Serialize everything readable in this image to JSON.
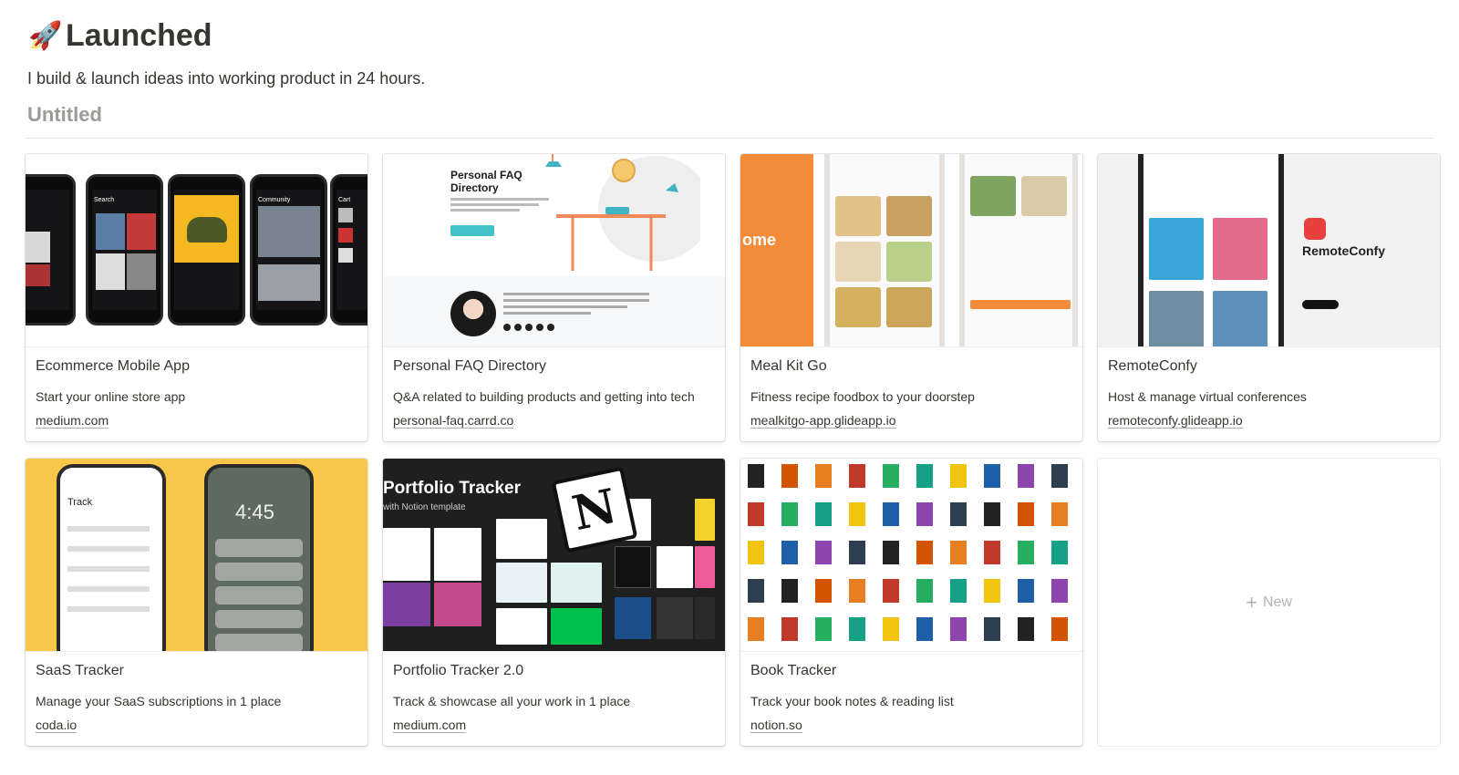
{
  "page": {
    "icon": "rocket-icon",
    "icon_glyph": "🚀",
    "title": "Launched",
    "description": "I build & launch ideas into working product in 24 hours.",
    "view_name": "Untitled"
  },
  "cards": [
    {
      "name": "Ecommerce Mobile App",
      "sub": "Start your online store app",
      "link": "medium.com"
    },
    {
      "name": "Personal FAQ Directory",
      "sub": "Q&A related to building products and getting into tech",
      "link": "personal-faq.carrd.co"
    },
    {
      "name": "Meal Kit Go",
      "sub": "Fitness recipe foodbox to your doorstep",
      "link": "mealkitgo-app.glideapp.io"
    },
    {
      "name": "RemoteConfy",
      "sub": "Host & manage virtual conferences",
      "link": "remoteconfy.glideapp.io"
    },
    {
      "name": "SaaS Tracker",
      "sub": "Manage your SaaS subscriptions in 1 place",
      "link": "coda.io"
    },
    {
      "name": "Portfolio Tracker 2.0",
      "sub": "Track & showcase all your work in 1 place",
      "link": "medium.com"
    },
    {
      "name": "Book Tracker",
      "sub": "Track your book notes & reading list",
      "link": "notion.so"
    }
  ],
  "new_card": {
    "label": "New",
    "icon": "plus-icon",
    "icon_glyph": "+"
  },
  "thumbs": {
    "ecommerce": {
      "screens": [
        "Search",
        "Community",
        "Cart"
      ]
    },
    "faq": {
      "title_line1": "Personal FAQ",
      "title_line2": "Directory"
    },
    "meal": {
      "hero_text": "ome"
    },
    "remote": {
      "brand": "RemoteConfy"
    },
    "saas": {
      "clock": "4:45",
      "app_heading": "Track"
    },
    "portfolio": {
      "title": "Portfolio Tracker",
      "subtitle": "with Notion template",
      "logo_letter": "N"
    }
  },
  "colors": {
    "text": "#37352f",
    "muted": "#9b9a97",
    "faq_teal": "#44c2c8",
    "meal_orange": "#f28c3a",
    "saas_yellow": "#f7c64a",
    "remote_red": "#e8403f"
  }
}
